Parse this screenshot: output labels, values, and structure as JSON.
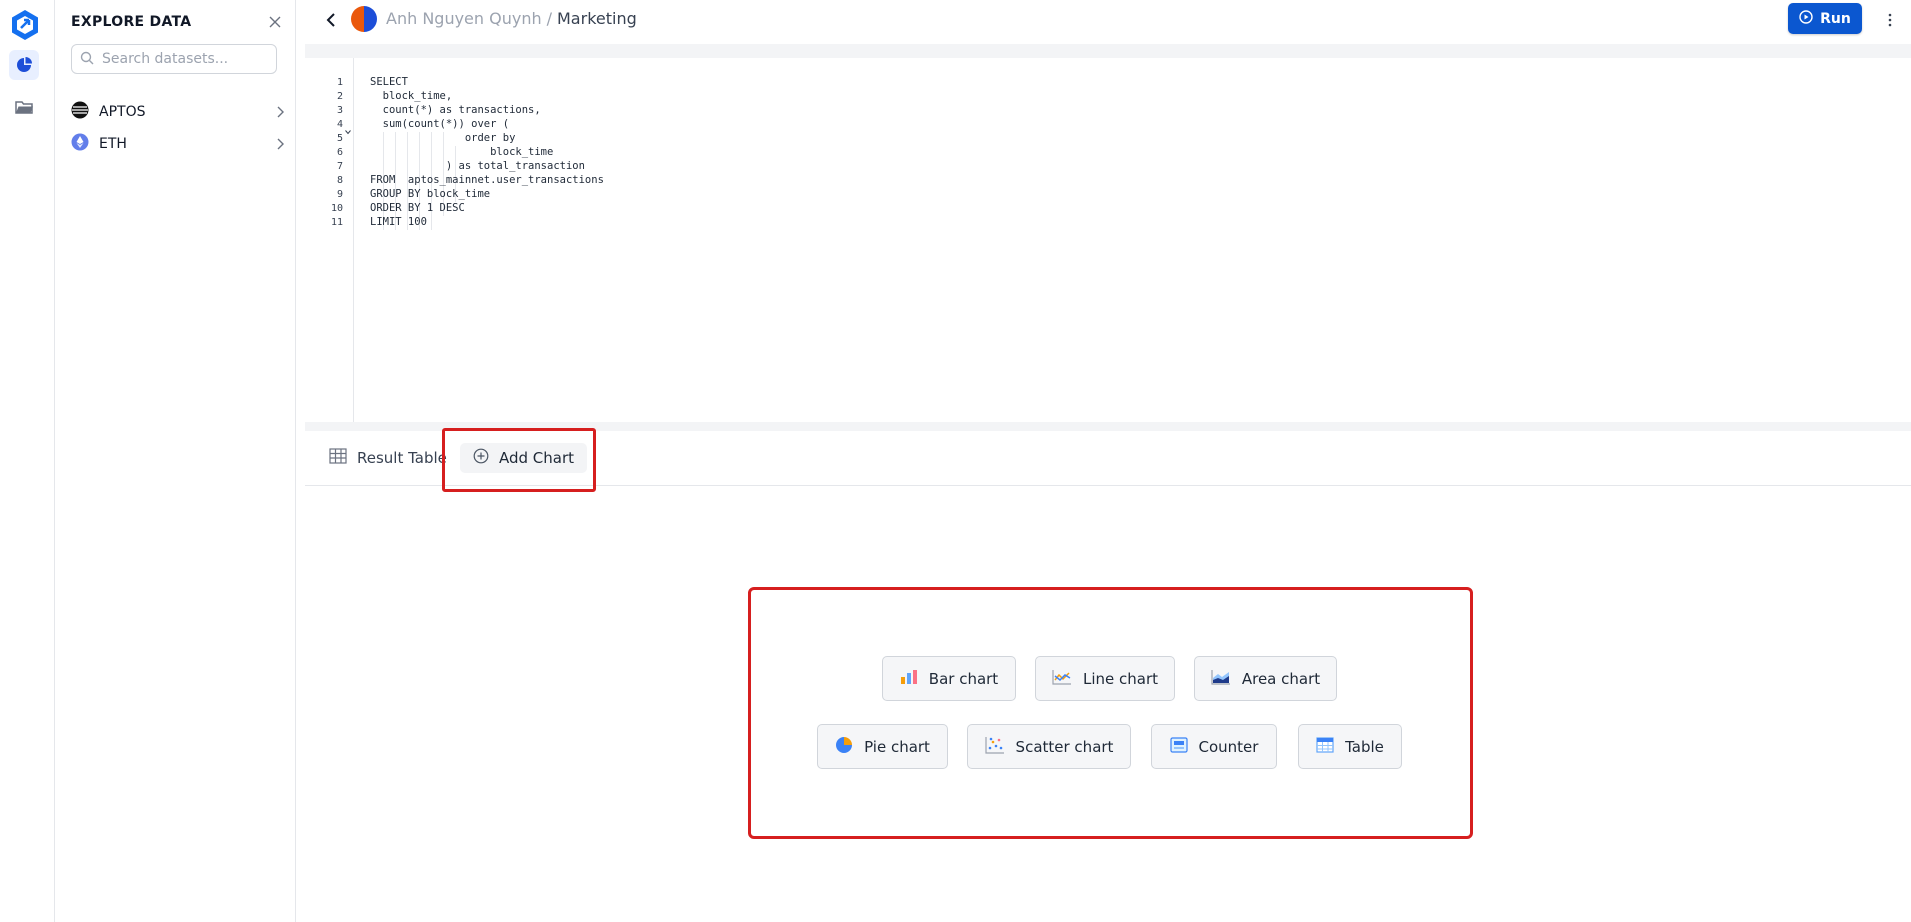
{
  "sidebar": {
    "title": "EXPLORE DATA",
    "search_placeholder": "Search datasets...",
    "datasets": [
      {
        "label": "APTOS",
        "icon": "aptos-icon"
      },
      {
        "label": "ETH",
        "icon": "ethereum-icon"
      }
    ]
  },
  "header": {
    "owner": "Anh Nguyen Quynh",
    "separator": "/",
    "project": "Marketing",
    "run_label": "Run"
  },
  "editor": {
    "line_numbers": [
      "1",
      "2",
      "3",
      "4",
      "5",
      "6",
      "7",
      "8",
      "9",
      "10",
      "11"
    ],
    "code_lines": [
      "SELECT",
      "  block_time,",
      "  count(*) as transactions,",
      "  sum(count(*)) over (",
      "               order by",
      "                   block_time",
      "            ) as total_transaction",
      "FROM  aptos_mainnet.user_transactions",
      "GROUP BY block_time",
      "ORDER BY 1 DESC",
      "LIMIT 100"
    ]
  },
  "tabs": {
    "result_table": "Result Table",
    "add_chart": "Add Chart"
  },
  "chart_types": {
    "bar": "Bar chart",
    "line": "Line chart",
    "area": "Area chart",
    "pie": "Pie chart",
    "scatter": "Scatter chart",
    "counter": "Counter",
    "table": "Table"
  },
  "colors": {
    "primary": "#0b57d0",
    "highlight": "#d61f1f"
  }
}
